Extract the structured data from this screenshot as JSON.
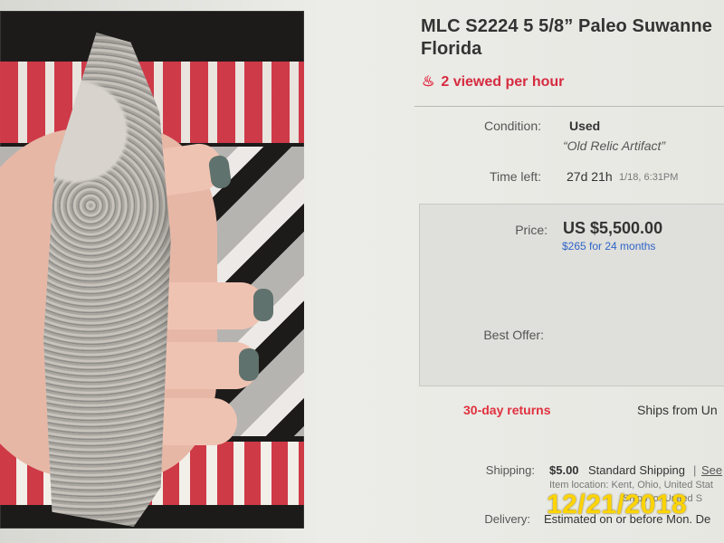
{
  "listing": {
    "title_line1": "MLC S2224 5 5/8” Paleo Suwanne",
    "title_line2": "Florida",
    "views": "2 viewed per hour",
    "condition_label": "Condition:",
    "condition_value": "Used",
    "condition_note": "“Old Relic Artifact”",
    "time_left_label": "Time left:",
    "time_left_value": "27d 21h",
    "time_left_date": "1/18, 6:31PM",
    "price_label": "Price:",
    "price_value": "US $5,500.00",
    "monthly_payment": "$265 for 24 months",
    "best_offer_label": "Best Offer:",
    "returns": "30-day returns",
    "ships_from": "Ships from Un",
    "shipping_label": "Shipping:",
    "shipping_cost": "$5.00",
    "shipping_method": "Standard Shipping",
    "shipping_see": "See",
    "item_location": "Item location: Kent, Ohio, United Stat",
    "ships_to": "Ships to: United S",
    "date_stamp": "12/21/2018",
    "delivery_label": "Delivery:",
    "delivery_text": "Estimated on or before Mon. De"
  },
  "icons": {
    "views": "flame-icon"
  },
  "colors": {
    "red": "#d62b40",
    "blue": "#2f64c8",
    "date": "#ffd400"
  }
}
